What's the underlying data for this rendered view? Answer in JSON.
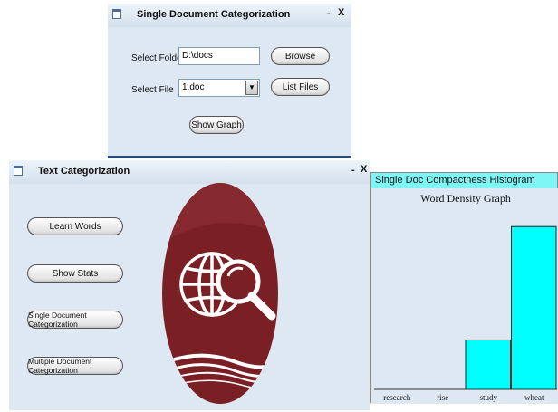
{
  "single_doc_window": {
    "title": "Single Document Categorization",
    "minimize": "-",
    "close": "X",
    "select_folder_label": "Select Folder",
    "folder_value": "D:\\docs",
    "browse_label": "Browse",
    "select_file_label": "Select File",
    "file_value": "1.doc",
    "list_files_label": "List Files",
    "show_graph_label": "Show Graph"
  },
  "text_cat_window": {
    "title": "Text Categorization",
    "minimize": "-",
    "close": "X",
    "learn_words_label": "Learn Words",
    "show_stats_label": "Show Stats",
    "single_doc_label": "Single Document Categorization",
    "multiple_doc_label": "Multiple Document Categorization"
  },
  "histogram_window": {
    "title": "Single Doc Compactness Histogram"
  },
  "chart_data": {
    "type": "bar",
    "title": "Word Density Graph",
    "categories": [
      "research",
      "rise",
      "study",
      "wheat"
    ],
    "values": [
      0,
      0,
      27,
      89
    ],
    "ylim": [
      0,
      100
    ],
    "bar_color": "#00ffff",
    "xlabel": "",
    "ylabel": ""
  }
}
